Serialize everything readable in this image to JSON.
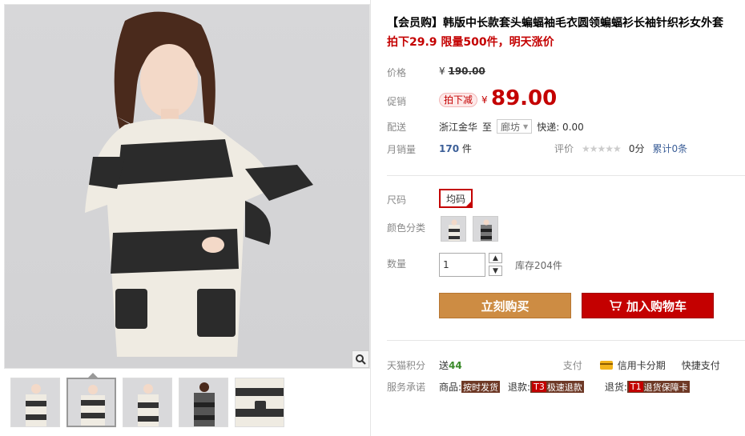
{
  "product": {
    "title": "【会员购】韩版中长款套头蝙蝠袖毛衣圆领蝙蝠衫长袖针织衫女外套",
    "promo_line": "拍下29.9 限量500件，明天涨价"
  },
  "price": {
    "label": "价格",
    "currency": "¥",
    "original": "190.00"
  },
  "promotion": {
    "label": "促销",
    "tag": "拍下减",
    "currency": "¥",
    "price": "89.00"
  },
  "shipping": {
    "label": "配送",
    "from": "浙江金华",
    "to_word": "至",
    "to_city": "廊坊",
    "express": "快递: 0.00"
  },
  "sales": {
    "label": "月销量",
    "count": "170",
    "unit": "件"
  },
  "rating": {
    "label": "评价",
    "stars": "★★★★★",
    "score": "0分",
    "total": "累计0条"
  },
  "options": {
    "size_label": "尺码",
    "size_value": "均码",
    "color_label": "颜色分类",
    "qty_label": "数量",
    "qty_value": "1",
    "stock": "库存204件"
  },
  "actions": {
    "buy": "立刻购买",
    "cart": "加入购物车"
  },
  "points": {
    "label": "天猫积分",
    "prefix": "送",
    "value": "44",
    "pay_label": "支付",
    "credit": "信用卡分期",
    "quick_pay": "快捷支付"
  },
  "service": {
    "label": "服务承诺",
    "goods_label": "商品:",
    "goods_badge": "按时发货",
    "refund_label": "退款:",
    "refund_code": "T3",
    "refund_badge": "极速退款",
    "return_label": "退货:",
    "return_code": "T1",
    "return_badge": "退货保障卡"
  },
  "colors": {
    "accent": "#c40000",
    "buy": "#cd8c43",
    "link": "#3c5f98"
  }
}
